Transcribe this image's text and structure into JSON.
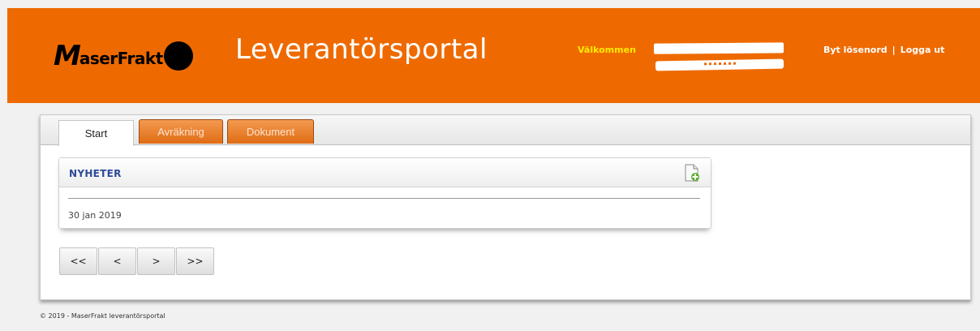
{
  "header": {
    "logo_m": "M",
    "logo_text": "aserFrakt",
    "portal_title": "Leverantörsportal",
    "welcome_label": "Välkommen",
    "links": [
      "Byt lösenord",
      "Logga ut"
    ],
    "separator": "|",
    "colors": {
      "band": "#ee6a00",
      "welcome": "#ffea00"
    }
  },
  "tabs": [
    {
      "label": "Start",
      "active": true
    },
    {
      "label": "Avräkning",
      "active": false
    },
    {
      "label": "Dokument",
      "active": false
    }
  ],
  "news": {
    "title": "NYHETER",
    "add_icon": "add-document-icon",
    "date": "30 jan 2019"
  },
  "pager": [
    "<<",
    "<",
    ">",
    ">>"
  ],
  "footer": "© 2019 - MaserFrakt leverantörsportal"
}
